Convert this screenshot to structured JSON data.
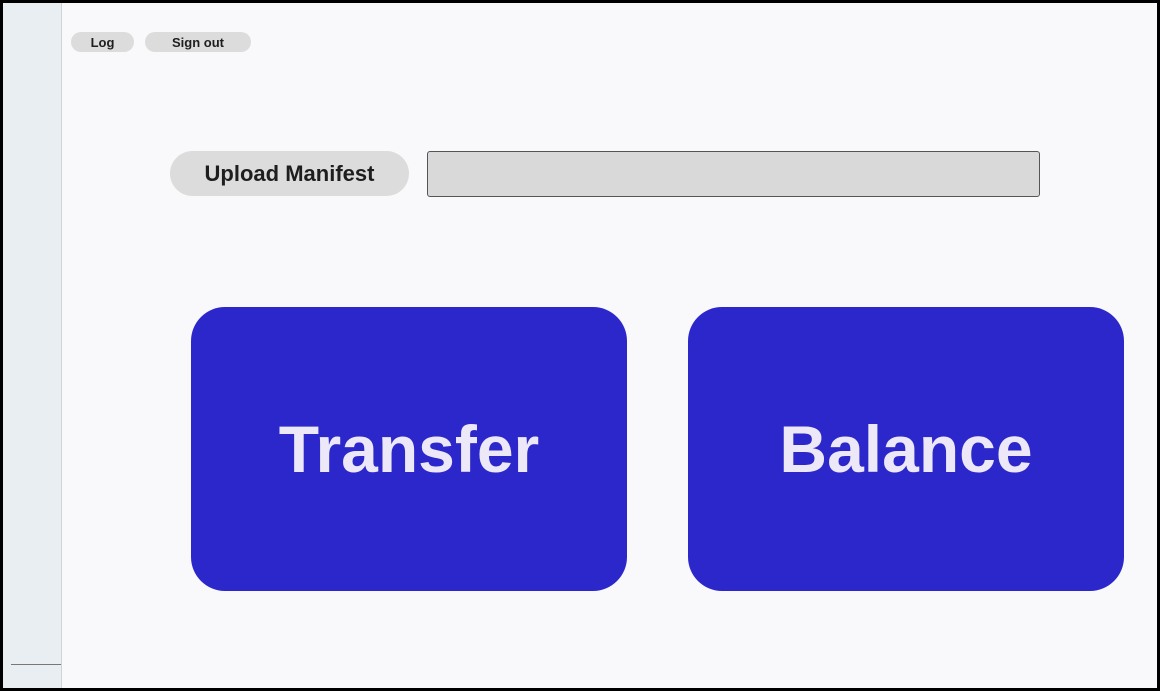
{
  "header": {
    "log_label": "Log",
    "sign_out_label": "Sign out"
  },
  "upload": {
    "label": "Upload Manifest",
    "value": "",
    "placeholder": ""
  },
  "actions": {
    "transfer_label": "Transfer",
    "balance_label": "Balance"
  },
  "colors": {
    "primary_button": "#2c27cb",
    "primary_button_text": "#ece8f8",
    "pill_background": "#dcdcdc",
    "page_background": "#f9f9fb",
    "sidebar_background": "#e9eef2"
  }
}
